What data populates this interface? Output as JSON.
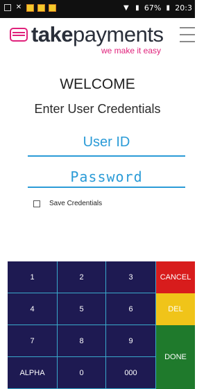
{
  "status_bar": {
    "icons": [
      "image-icon",
      "close-icon",
      "app-icon",
      "app-icon",
      "app-icon"
    ],
    "right_icons": [
      "wifi-icon",
      "signal-icon"
    ],
    "battery": "67%",
    "time": "20:3"
  },
  "brand": {
    "name_bold": "take",
    "name_rest": "payments",
    "tagline": "we make it easy",
    "color": "#e0217b"
  },
  "login": {
    "welcome": "WELCOME",
    "subtitle": "Enter User Credentials",
    "user_id_placeholder": "User ID",
    "password_placeholder": "Password",
    "save_label": "Save Credentials",
    "save_checked": false,
    "accent_color": "#2a9bd7"
  },
  "keypad": {
    "keys": [
      "1",
      "2",
      "3",
      "4",
      "5",
      "6",
      "7",
      "8",
      "9",
      "ALPHA",
      "0",
      "000"
    ],
    "cancel": "CANCEL",
    "del": "DEL",
    "done": "DONE",
    "colors": {
      "keys": "#1e1a52",
      "cancel": "#d81c1c",
      "del": "#f0c419",
      "done": "#1f7a2c"
    }
  }
}
